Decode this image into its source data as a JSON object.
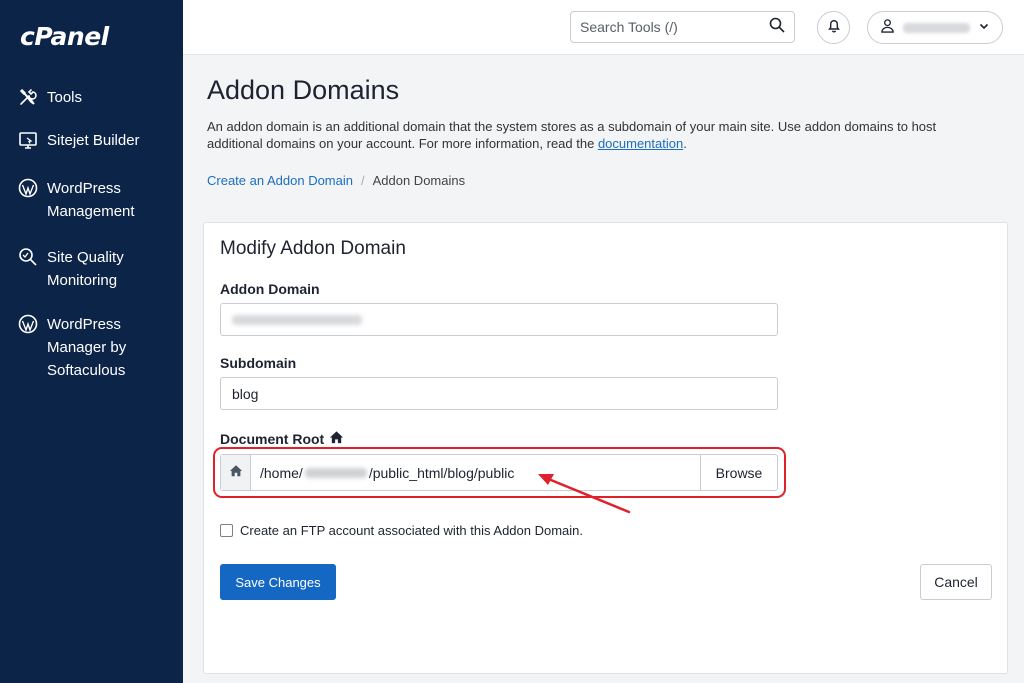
{
  "brand": {
    "logo_text": "cPanel"
  },
  "sidebar": {
    "items": [
      {
        "label": "Tools",
        "icon": "tools-icon"
      },
      {
        "label": "Sitejet Builder",
        "icon": "sitejet-icon"
      },
      {
        "label": "WordPress Management",
        "icon": "wordpress-icon"
      },
      {
        "label": "Site Quality Monitoring",
        "icon": "site-quality-icon"
      },
      {
        "label": "WordPress Manager by Softaculous",
        "icon": "wordpress-icon"
      }
    ]
  },
  "header": {
    "search_placeholder": "Search Tools (/)"
  },
  "page": {
    "title": "Addon Domains",
    "description_text": "An addon domain is an additional domain that the system stores as a subdomain of your main site. Use addon domains to host additional domains on your account. For more information, read the ",
    "description_link": "documentation",
    "description_end": ".",
    "breadcrumb": {
      "link": "Create an Addon Domain",
      "separator": "/",
      "current": "Addon Domains"
    }
  },
  "form": {
    "title": "Modify Addon Domain",
    "addon_domain_label": "Addon Domain",
    "subdomain_label": "Subdomain",
    "subdomain_value": "blog",
    "document_root_label": "Document Root",
    "document_root_prefix": "/home/",
    "document_root_suffix": "/public_html/blog/public",
    "browse_label": "Browse",
    "ftp_label": "Create an FTP account associated with this Addon Domain.",
    "save_label": "Save Changes",
    "cancel_label": "Cancel"
  },
  "colors": {
    "sidebar_bg": "#0c2448",
    "primary_button": "#1567c4",
    "link": "#1b6ec2",
    "highlight": "#e0202b"
  }
}
